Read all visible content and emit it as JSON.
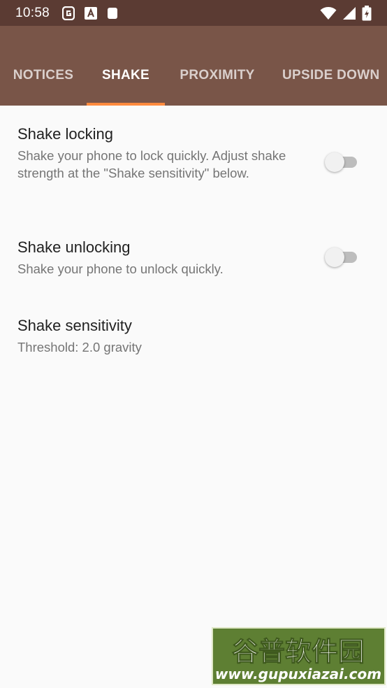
{
  "status_bar": {
    "time": "10:58",
    "left_icons": [
      "g-app-icon",
      "font-a-icon",
      "sd-card-icon"
    ],
    "right_icons": [
      "wifi-icon",
      "signal-icon",
      "battery-charging-icon"
    ]
  },
  "tabs": [
    {
      "label": "NOTICES",
      "active": false
    },
    {
      "label": "SHAKE",
      "active": true
    },
    {
      "label": "PROXIMITY",
      "active": false
    },
    {
      "label": "UPSIDE DOWN",
      "active": false
    }
  ],
  "preferences": [
    {
      "title": "Shake locking",
      "summary": "Shake your phone to lock quickly. Adjust shake strength at the \"Shake sensitivity\" below.",
      "switch_on": false
    },
    {
      "title": "Shake unlocking",
      "summary": "Shake your phone to unlock quickly.",
      "switch_on": false
    },
    {
      "title": "Shake sensitivity",
      "summary": "Threshold: 2.0 gravity"
    }
  ],
  "watermark": {
    "text": "谷普软件园",
    "url": "www.gupuxiazai.com"
  },
  "colors": {
    "status_bar": "#5b3b33",
    "app_bar": "#795548",
    "tab_indicator": "#ff8a3d",
    "background": "#fafafa"
  }
}
